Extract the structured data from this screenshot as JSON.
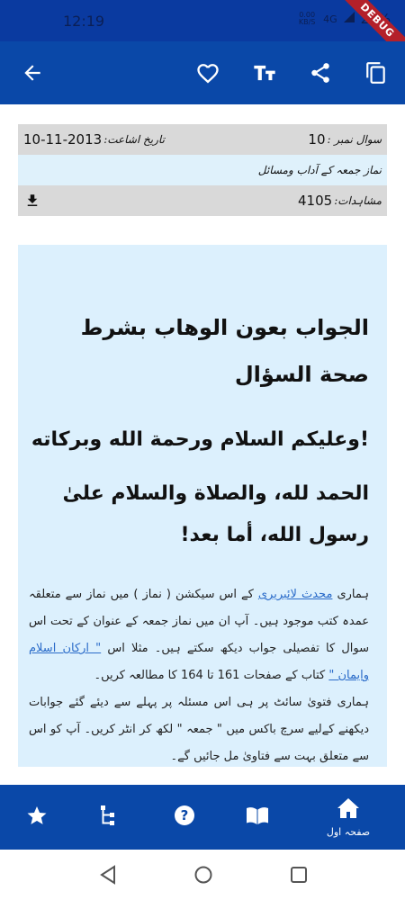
{
  "status": {
    "time": "12:19",
    "net_speed": "0.00\nKB/S",
    "network": "4G",
    "battery": "29%",
    "debug": "DEBUG"
  },
  "icons": {
    "back": "arrow-left-icon",
    "favorite": "heart-icon",
    "font": "text-size-icon",
    "share": "share-icon",
    "copy": "copy-icon",
    "download": "download-icon"
  },
  "question": {
    "number_label": "سوال نمبر :",
    "number": "10",
    "date_label": "تاریخ اشاعت:",
    "date": "10-11-2013",
    "title": "نماز جمعہ کے آداب ومسائل",
    "views_label": "مشاہدات:",
    "views": "4105"
  },
  "answer": {
    "heading": "الجواب بعون الوهاب بشرط صحة السؤال",
    "greeting": "!وعلیکم السلام ورحمة الله وبرکاته",
    "praise": "الحمد لله، والصلاة والسلام علىٰ رسول الله، أما بعد!",
    "urdu_p1_a": "ہماری",
    "urdu_link1": "محدث لائبریری",
    "urdu_p1_b": "کے اس سیکشن ( نماز ) میں نماز سے متعلقہ عمدہ کتب موجود ہیں۔ آپ ان میں نماز جمعہ کے عنوان کے تحت اس سوال کا تفصیلی جواب دیکھ سکتے ہیں۔ مثلا اس",
    "urdu_link2": "\" ارکان اسلام وایمان \"",
    "urdu_p1_c": "کتاب کے صفحات 161 تا 164 کا مطالعہ کریں۔",
    "urdu_p2": "ہماری فتویٰ سائٹ پر ہی اس مسئلہ پر پہلے سے دیئے گئے جوابات دیکھنے کےلیے سرچ باکس میں \" جمعہ \" لکھ کر انٹر کریں۔ آپ کو اس سے متعلق بہت سے فتاویٰ مل جائیں گے۔"
  },
  "bottom_nav": {
    "home_label": "صفحہ اول",
    "star": "star-icon",
    "tree": "sitemap-icon",
    "help": "help-circle-icon",
    "book": "book-open-icon",
    "home": "home-icon"
  },
  "colors": {
    "primary": "#0a48a8",
    "content_bg": "#dcf0fd",
    "row_gray": "#d9d9d9",
    "link": "#2a6bc9"
  }
}
